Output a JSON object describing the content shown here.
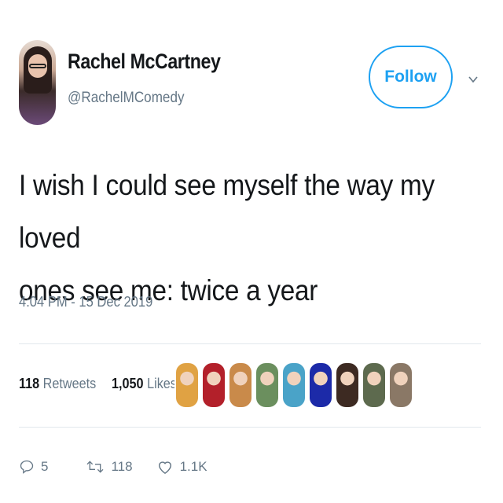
{
  "author": {
    "name": "Rachel McCartney",
    "handle": "@RachelMComedy"
  },
  "follow_label": "Follow",
  "tweet": {
    "line1": "I wish I could see myself the way my loved",
    "line2": "ones see me: twice a year"
  },
  "timestamp": "4:04 PM - 15 Dec 2019",
  "stats": {
    "retweets_count": "118",
    "retweets_label": "Retweets",
    "likes_count": "1,050",
    "likes_label": "Likes"
  },
  "likers": [
    "#e0a243",
    "#b3202a",
    "#c98a4a",
    "#6b8f5e",
    "#4aa3c8",
    "#1c2aa8",
    "#3d2a22",
    "#5d6a4e",
    "#8a7866"
  ],
  "actions": {
    "replies": "5",
    "retweets": "118",
    "likes": "1.1K"
  },
  "colors": {
    "accent": "#1da1f2",
    "secondary_text": "#657786",
    "text": "#14171a"
  }
}
